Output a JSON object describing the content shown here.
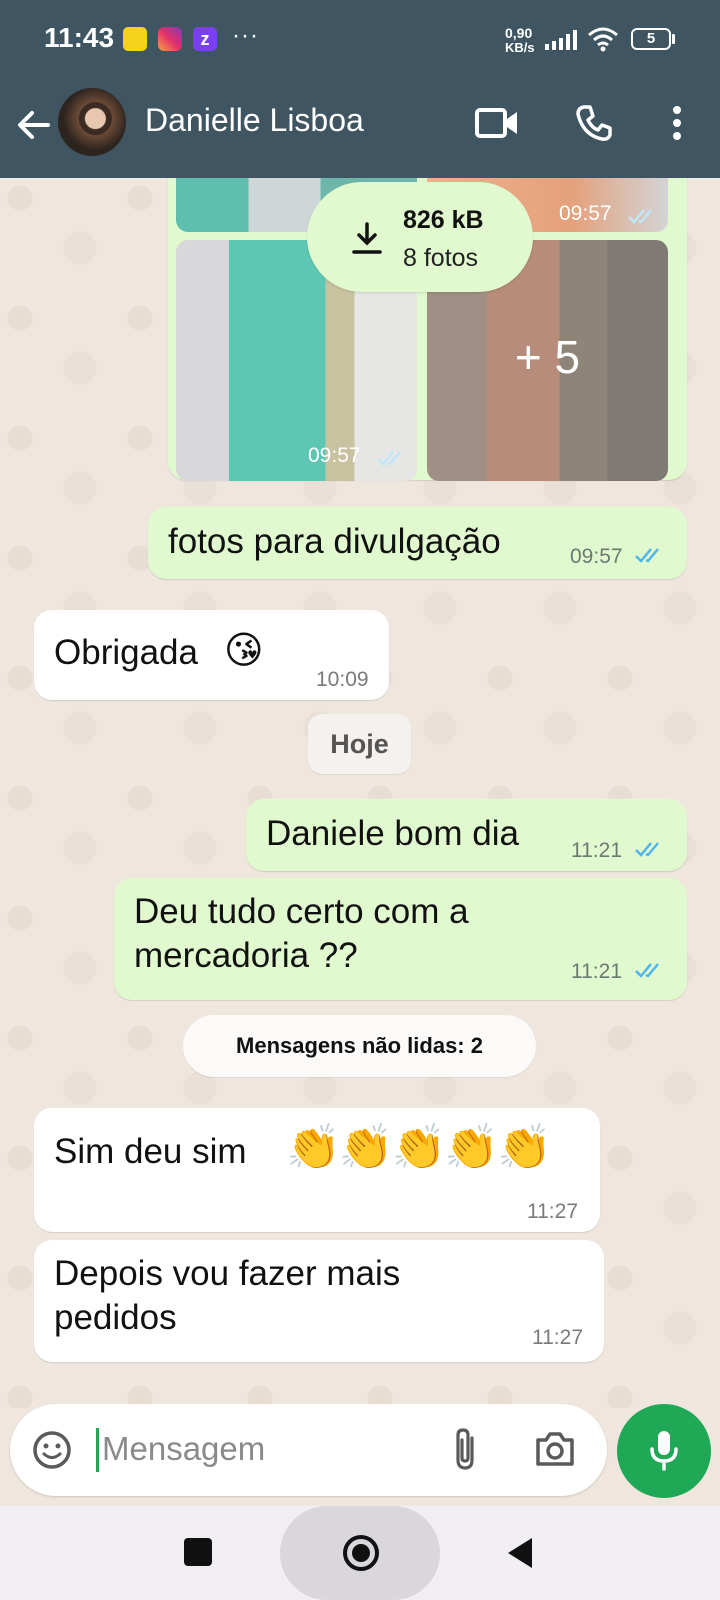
{
  "status_bar": {
    "time": "11:43",
    "net_speed_value": "0,90",
    "net_speed_unit": "KB/s",
    "battery": "5",
    "more": "···"
  },
  "header": {
    "contact_name": "Danielle Lisboa"
  },
  "chat": {
    "album": {
      "top_time": "09:57",
      "bottom_time": "09:57",
      "more_count": "+ 5",
      "download_size": "826 kB",
      "download_count": "8 fotos"
    },
    "messages": [
      {
        "direction": "out",
        "text": "fotos para divulgação",
        "time": "09:57"
      },
      {
        "direction": "in",
        "text": "Obrigada",
        "emoji": "😘",
        "time": "10:09"
      },
      {
        "direction": "out",
        "text": "Daniele bom dia",
        "time": "11:21"
      },
      {
        "direction": "out",
        "text_line1": "Deu tudo certo com a",
        "text_line2": "mercadoria ??",
        "time": "11:21"
      },
      {
        "direction": "in",
        "text": "Sim deu sim",
        "emoji": "👏👏👏👏👏",
        "time": "11:27"
      },
      {
        "direction": "in",
        "text_line1": "Depois vou fazer mais",
        "text_line2": "pedidos",
        "time": "11:27"
      }
    ],
    "date_chip": "Hoje",
    "unread_chip": "Mensagens não lidas: 2"
  },
  "input": {
    "placeholder": "Mensagem"
  },
  "colors": {
    "header": "#3f5561",
    "outgoing_bubble": "#e1f9cf",
    "incoming_bubble": "#ffffff",
    "mic_button": "#1fa855",
    "read_ticks": "#4fb6ec"
  },
  "icons": [
    "back-arrow-icon",
    "video-call-icon",
    "phone-icon",
    "more-vert-icon",
    "download-icon",
    "emoji-icon",
    "attach-icon",
    "camera-icon",
    "mic-icon",
    "nav-recents-icon",
    "nav-home-icon",
    "nav-back-icon"
  ]
}
